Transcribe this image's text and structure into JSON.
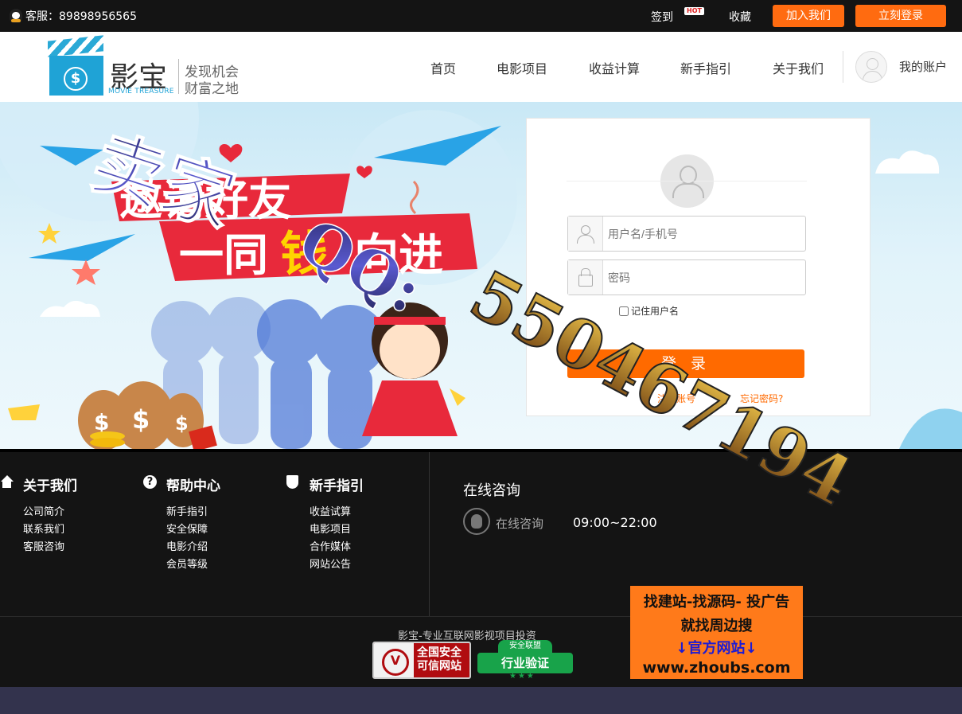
{
  "topbar": {
    "service": "客服：89898956565",
    "sign": "签到",
    "hot": "HOT",
    "favorite": "收藏",
    "join": "加入我们",
    "login": "立刻登录"
  },
  "logo": {
    "name": "影宝",
    "english": "MOVIE TREASURE",
    "dollar": "$",
    "slogan1": "发现机会",
    "slogan2": "财富之地"
  },
  "nav": {
    "items": [
      "首页",
      "电影项目",
      "收益计算",
      "新手指引",
      "关于我们"
    ],
    "account": "我的账户"
  },
  "banner": {
    "headline1": "邀请好友",
    "headline2": "一同",
    "headline_accent": "钱",
    "headline3": "向进"
  },
  "login": {
    "username_placeholder": "用户名/手机号",
    "password_placeholder": "密码",
    "remember": "记住用户名",
    "submit": "登 录",
    "register": "注册账号",
    "forgot": "忘记密码?"
  },
  "footer": {
    "col1": {
      "title": "关于我们",
      "links": [
        "公司简介",
        "联系我们",
        "客服咨询"
      ]
    },
    "col2": {
      "title": "帮助中心",
      "icon": "?",
      "links": [
        "新手指引",
        "安全保障",
        "电影介绍",
        "会员等级"
      ]
    },
    "col3": {
      "title": "新手指引",
      "links": [
        "收益试算",
        "电影项目",
        "合作媒体",
        "网站公告"
      ]
    },
    "consult_title": "在线咨询",
    "consult_label": "在线咨询",
    "hours": "09:00~22:00",
    "copyright": "影宝-专业互联网影视项目投资",
    "badge_trust1": "全国安全",
    "badge_trust2": "可信网站",
    "badge_verify_top": "安全联盟",
    "badge_verify": "行业验证",
    "badge_stars": "★★★"
  },
  "ad": {
    "line1": "找建站-找源码- 投广告",
    "line2": "就找周边搜",
    "line3": "↓官方网站↓",
    "line4": "www.zhoubs.com"
  },
  "watermark": {
    "text1": "卖家",
    "text2": "QQ:",
    "text3": "550467194"
  },
  "colors": {
    "accent": "#ff6a00",
    "topbar": "#141414",
    "brand_blue": "#1fa3d6"
  }
}
